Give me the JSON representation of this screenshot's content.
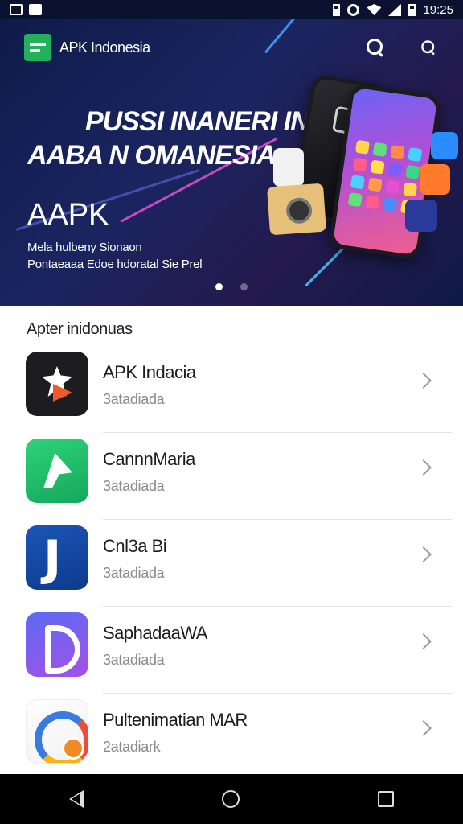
{
  "status_bar": {
    "time": "19:25"
  },
  "appbar": {
    "brand": "APK Indonesia"
  },
  "hero": {
    "line1": "PUSSI INANERI IN",
    "line2": "AABA N OMANESIA",
    "line3": "AAPK",
    "line4": "Mela hulbeny Sionaon",
    "line5": "Pontaeaaa Edoe hdoratal Sie Prel",
    "slide_count": 2,
    "active_slide": 1
  },
  "section_title": "Apter inidonuas",
  "apps": [
    {
      "name": "APK Indacia",
      "subtitle": "3atadiada"
    },
    {
      "name": "CannnMaria",
      "subtitle": "3atadiada"
    },
    {
      "name": "Cnl3a Bi",
      "subtitle": "3atadiada"
    },
    {
      "name": "SaphadaaWA",
      "subtitle": "3atadiada"
    },
    {
      "name": "Pultenimatian MAR",
      "subtitle": "2atadiark"
    }
  ],
  "colors": {
    "accent": "#23b05a",
    "hero_bg": "#1a2560"
  }
}
